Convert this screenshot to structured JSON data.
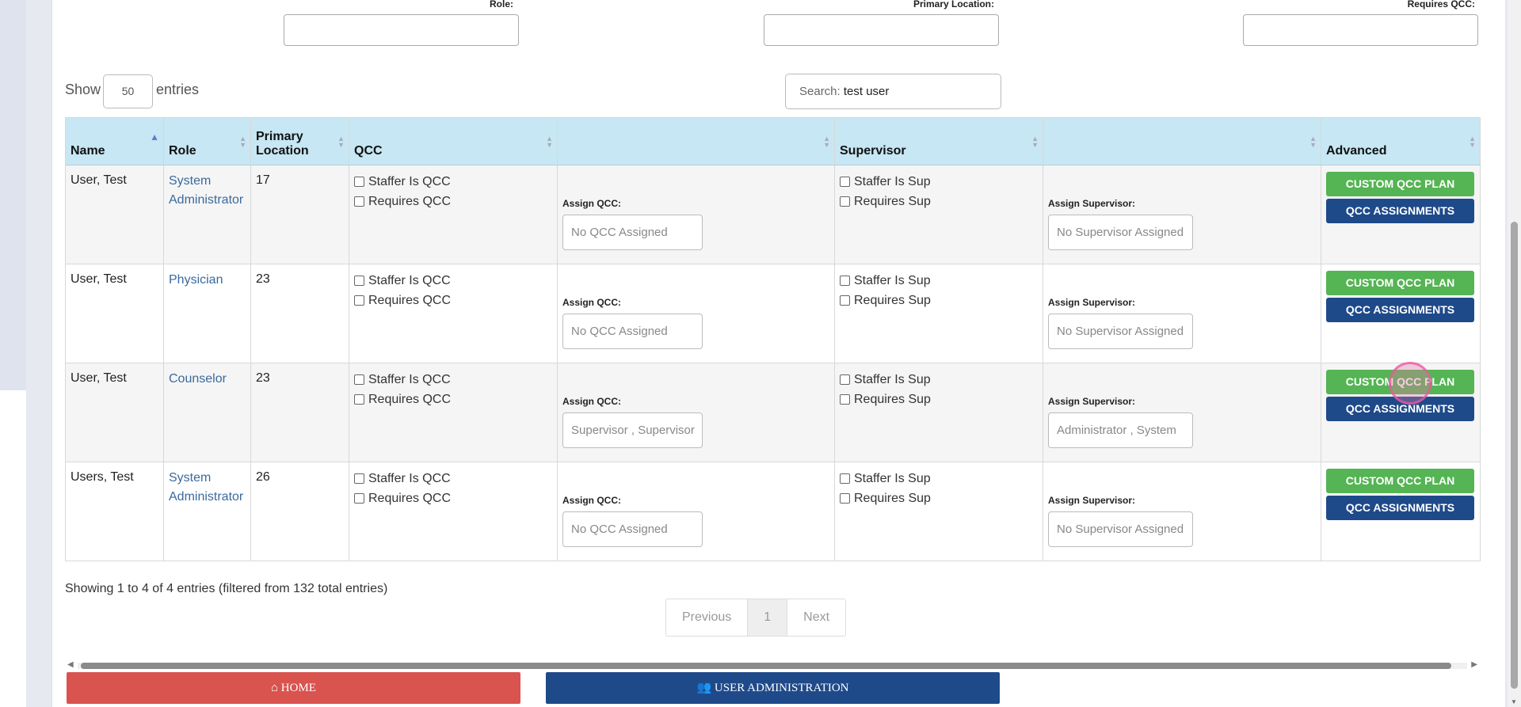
{
  "filters": {
    "role_label": "Role:",
    "primary_location_label": "Primary Location:",
    "requires_qcc_label": "Requires QCC:"
  },
  "length": {
    "show": "Show",
    "value": "50",
    "entries": "entries"
  },
  "search": {
    "label": "Search:",
    "value": "test user"
  },
  "table": {
    "headers": {
      "name": "Name",
      "role": "Role",
      "primary_location": "Primary Location",
      "qcc": "QCC",
      "supervisor": "Supervisor",
      "advanced": "Advanced"
    },
    "rows": [
      {
        "name": "User, Test",
        "role": "System Administrator",
        "location": "17",
        "staffer_is_qcc": "Staffer Is QCC",
        "requires_qcc": "Requires QCC",
        "assign_qcc_label": "Assign QCC:",
        "assign_qcc": "No QCC Assigned",
        "staffer_is_sup": "Staffer Is Sup",
        "requires_sup": "Requires Sup",
        "assign_sup_label": "Assign Supervisor:",
        "assign_sup": "No Supervisor Assigned",
        "btn_custom": "CUSTOM QCC PLAN",
        "btn_assign": "QCC ASSIGNMENTS"
      },
      {
        "name": "User, Test",
        "role": "Physician",
        "location": "23",
        "staffer_is_qcc": "Staffer Is QCC",
        "requires_qcc": "Requires QCC",
        "assign_qcc_label": "Assign QCC:",
        "assign_qcc": "No QCC Assigned",
        "staffer_is_sup": "Staffer Is Sup",
        "requires_sup": "Requires Sup",
        "assign_sup_label": "Assign Supervisor:",
        "assign_sup": "No Supervisor Assigned",
        "btn_custom": "CUSTOM QCC PLAN",
        "btn_assign": "QCC ASSIGNMENTS"
      },
      {
        "name": "User, Test",
        "role": "Counselor",
        "location": "23",
        "staffer_is_qcc": "Staffer Is QCC",
        "requires_qcc": "Requires QCC",
        "assign_qcc_label": "Assign QCC:",
        "assign_qcc": "Supervisor , Supervisor",
        "staffer_is_sup": "Staffer Is Sup",
        "requires_sup": "Requires Sup",
        "assign_sup_label": "Assign Supervisor:",
        "assign_sup": "Administrator , System",
        "btn_custom": "CUSTOM QCC PLAN",
        "btn_assign": "QCC ASSIGNMENTS"
      },
      {
        "name": "Users, Test",
        "role": "System Administrator",
        "location": "26",
        "staffer_is_qcc": "Staffer Is QCC",
        "requires_qcc": "Requires QCC",
        "assign_qcc_label": "Assign QCC:",
        "assign_qcc": "No QCC Assigned",
        "staffer_is_sup": "Staffer Is Sup",
        "requires_sup": "Requires Sup",
        "assign_sup_label": "Assign Supervisor:",
        "assign_sup": "No Supervisor Assigned",
        "btn_custom": "CUSTOM QCC PLAN",
        "btn_assign": "QCC ASSIGNMENTS"
      }
    ]
  },
  "info": "Showing 1 to 4 of 4 entries (filtered from 132 total entries)",
  "pager": {
    "previous": "Previous",
    "page": "1",
    "next": "Next"
  },
  "footer": {
    "home": "HOME",
    "user_admin": "USER ADMINISTRATION"
  },
  "colors": {
    "header_bg": "#c6e7f3",
    "green": "#55b454",
    "navy": "#1e4a8a",
    "home_red": "#d9534f",
    "link": "#3a6a9c"
  }
}
